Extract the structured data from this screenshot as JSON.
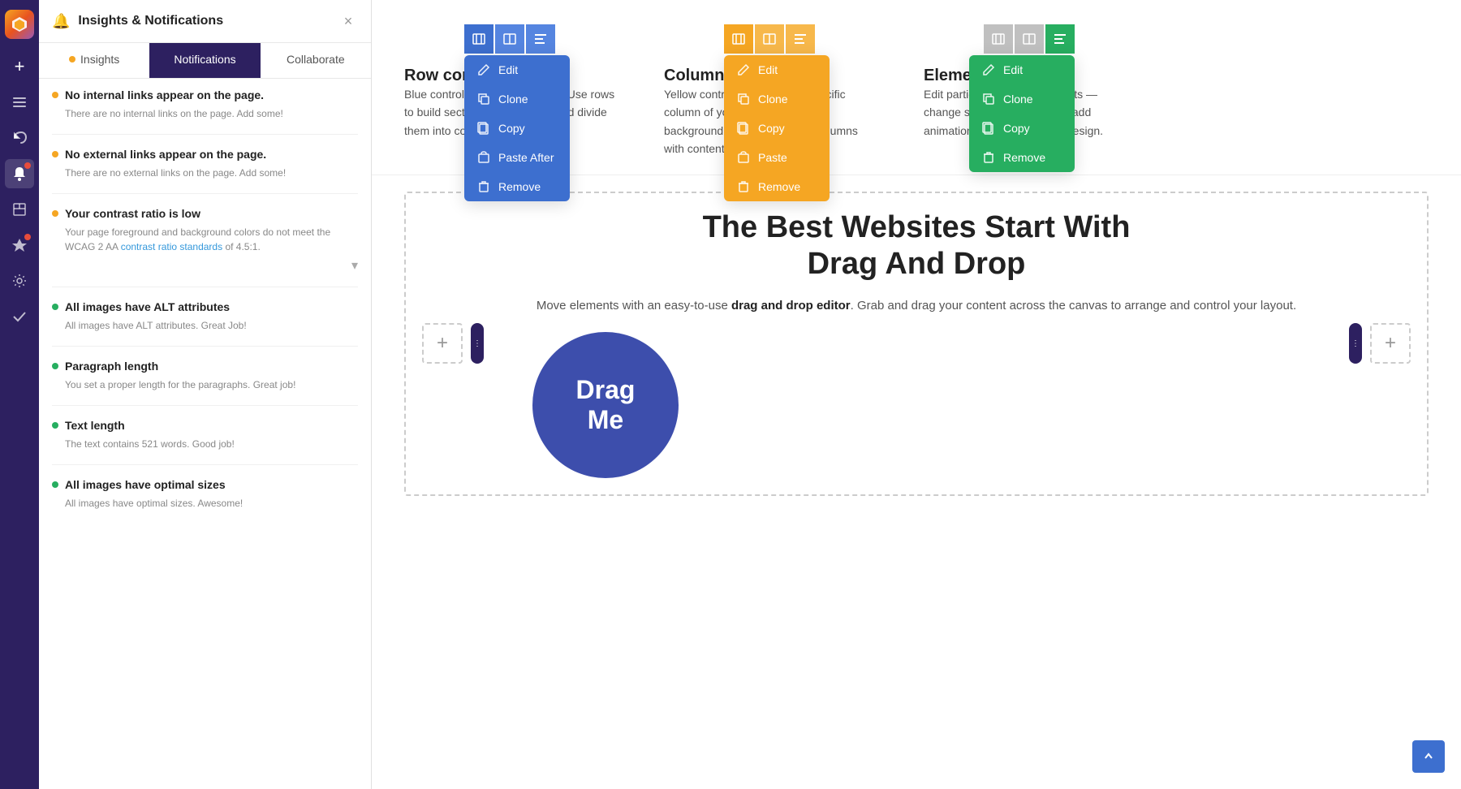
{
  "app": {
    "logo_alt": "App Logo"
  },
  "panel": {
    "header_icon": "🔔",
    "title": "Insights & Notifications",
    "close_label": "×",
    "tabs": [
      {
        "id": "insights",
        "label": "Insights",
        "has_dot": true,
        "active": false
      },
      {
        "id": "notifications",
        "label": "Notifications",
        "active": true
      },
      {
        "id": "collaborate",
        "label": "Collaborate",
        "active": false
      }
    ]
  },
  "insights": [
    {
      "id": "internal-links",
      "dot": "orange",
      "title": "No internal links appear on the page.",
      "desc": "There are no internal links on the page. Add some!"
    },
    {
      "id": "external-links",
      "dot": "orange",
      "title": "No external links appear on the page.",
      "desc": "There are no external links on the page. Add some!"
    },
    {
      "id": "contrast-ratio",
      "dot": "orange",
      "title": "Your contrast ratio is low",
      "desc_prefix": "Your page foreground and background colors do not meet the WCAG 2 AA ",
      "desc_link": "contrast ratio standards",
      "desc_suffix": " of 4.5:1."
    },
    {
      "id": "alt-attributes",
      "dot": "green",
      "title": "All images have ALT attributes",
      "desc": "All images have ALT attributes. Great Job!"
    },
    {
      "id": "paragraph-length",
      "dot": "green",
      "title": "Paragraph length",
      "desc": "You set a proper length for the paragraphs. Great job!"
    },
    {
      "id": "text-length",
      "dot": "green",
      "title": "Text length",
      "desc": "The text contains 521 words. Good job!"
    },
    {
      "id": "image-sizes",
      "dot": "green",
      "title": "All images have optimal sizes",
      "desc": "All images have optimal sizes. Awesome!"
    }
  ],
  "controls": [
    {
      "id": "row-controls",
      "label": "Row controls",
      "desc": "Blue controls to represent rows. Use rows to build sections of your page and divide them into columns.",
      "color": "blue",
      "menu_items": [
        {
          "icon": "edit",
          "label": "Edit"
        },
        {
          "icon": "clone",
          "label": "Clone"
        },
        {
          "icon": "copy",
          "label": "Copy"
        },
        {
          "icon": "paste",
          "label": "Paste After"
        },
        {
          "icon": "remove",
          "label": "Remove"
        }
      ]
    },
    {
      "id": "column-controls",
      "label": "Column controls",
      "desc": "Yellow controls to adjust the specific column of your row. Change the background color and fill your columns with content elements.",
      "color": "yellow",
      "menu_items": [
        {
          "icon": "edit",
          "label": "Edit"
        },
        {
          "icon": "clone",
          "label": "Clone"
        },
        {
          "icon": "copy",
          "label": "Copy"
        },
        {
          "icon": "paste",
          "label": "Paste"
        },
        {
          "icon": "remove",
          "label": "Remove"
        }
      ]
    },
    {
      "id": "element-controls",
      "label": "Element controls",
      "desc": "Edit particular content elements — change styling, set links, and add animations to create unique design.",
      "color": "green",
      "menu_items": [
        {
          "icon": "edit",
          "label": "Edit"
        },
        {
          "icon": "clone",
          "label": "Clone"
        },
        {
          "icon": "copy",
          "label": "Copy"
        },
        {
          "icon": "remove",
          "label": "Remove"
        }
      ]
    }
  ],
  "dnd_section": {
    "title_line1": "The Best Websites Start With",
    "title_line2": "Drag And Drop",
    "subtitle_prefix": "Move elements with an easy-to-use ",
    "subtitle_bold": "drag and drop editor",
    "subtitle_suffix": ". Grab and drag your content across the canvas to arrange and control your layout.",
    "drag_me_line1": "Drag",
    "drag_me_line2": "Me"
  },
  "sidebar": {
    "icons": [
      {
        "id": "add",
        "symbol": "+",
        "interactable": true
      },
      {
        "id": "layers",
        "symbol": "☰",
        "interactable": true
      },
      {
        "id": "undo",
        "symbol": "↩",
        "interactable": true
      },
      {
        "id": "notifications",
        "symbol": "🔔",
        "badge": true,
        "interactable": true,
        "active": true
      },
      {
        "id": "pages",
        "symbol": "⬜",
        "interactable": true
      },
      {
        "id": "interactions",
        "symbol": "⚡",
        "badge_red": true,
        "interactable": true
      },
      {
        "id": "settings",
        "symbol": "⚙",
        "interactable": true
      },
      {
        "id": "check",
        "symbol": "✓",
        "interactable": true
      }
    ]
  }
}
